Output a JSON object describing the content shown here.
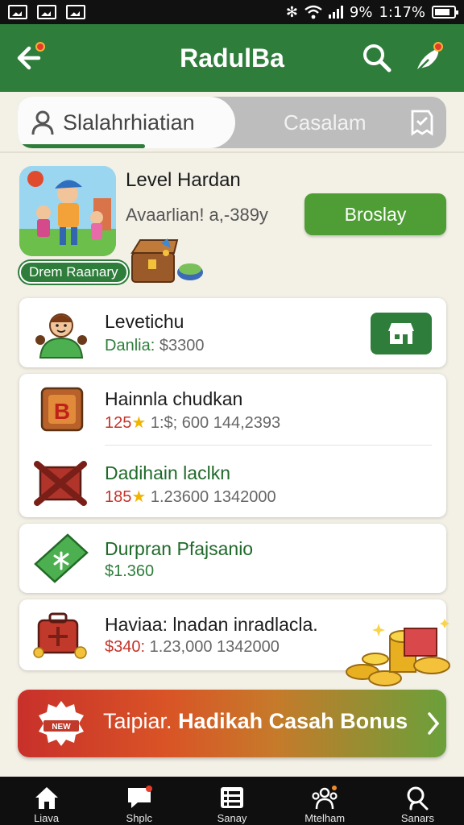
{
  "status_bar": {
    "battery_text": "9%",
    "time": "1:17%"
  },
  "app_bar": {
    "title": "RadulBa"
  },
  "tabs": [
    {
      "label": "Slalahrhiatian",
      "active": true
    },
    {
      "label": "Casalam",
      "active": false
    }
  ],
  "featured": {
    "title": "Level Hardan",
    "subtitle": "Avaarlian! a,-389y",
    "badge": "Drem Raanary",
    "button_label": "Broslay"
  },
  "rows": [
    {
      "title": "Levetichu",
      "sub_prefix": "Danlia:",
      "sub_rest": " $3300",
      "icon": "person-avatar-icon"
    },
    {
      "title": "Hainnla chudkan",
      "sub_prefix": "125",
      "sub_rest": " 1:$; 600  144,2393",
      "icon": "b-block-icon"
    },
    {
      "title": "Dadihain laclkn",
      "sub_prefix": "185",
      "sub_rest": " 1.23600  1342000",
      "icon": "red-x-crate-icon"
    },
    {
      "title": "Durpran Pfajsanio",
      "sub_prefix": "$1.360",
      "sub_rest": "",
      "icon": "green-ticket-icon"
    },
    {
      "title": "Haviaa: lnadan inradlacla.",
      "sub_prefix": "$340:",
      "sub_rest": " 1.23,000  1342000",
      "icon": "red-case-icon"
    }
  ],
  "bonus": {
    "text_lead": "Taipiar. ",
    "text_bold": "Hadikah Casah Bonus"
  },
  "bottom_nav": [
    {
      "label": "Liava",
      "icon": "home-icon"
    },
    {
      "label": "Shplc",
      "icon": "chat-icon"
    },
    {
      "label": "Sanay",
      "icon": "list-icon"
    },
    {
      "label": "Mtelham",
      "icon": "team-icon"
    },
    {
      "label": "Sanars",
      "icon": "search-icon"
    }
  ],
  "colors": {
    "primary": "#2e7d3b",
    "button_green": "#4f9e35",
    "accent_red": "#c6332a",
    "background": "#f3f0e6"
  }
}
